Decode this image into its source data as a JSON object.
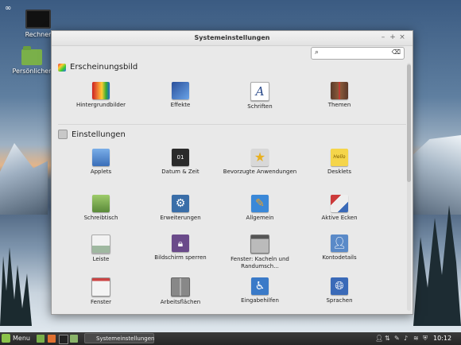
{
  "desktop": {
    "icons": [
      {
        "label": "Rechner",
        "icon": "computer-icon"
      },
      {
        "label": "Persönlicher",
        "icon": "home-folder-icon"
      }
    ]
  },
  "window": {
    "title": "Systemeinstellungen",
    "controls": {
      "minimize": "–",
      "maximize": "+",
      "close": "×"
    },
    "search": {
      "placeholder": ""
    }
  },
  "sections": [
    {
      "title": "Erscheinungsbild",
      "items": [
        {
          "label": "Hintergrundbilder",
          "color": "#d23a2a",
          "icon": "wallpaper-icon"
        },
        {
          "label": "Effekte",
          "color": "#3a78c8",
          "icon": "effects-icon"
        },
        {
          "label": "Schriften",
          "color": "#ffffff",
          "icon": "fonts-icon"
        },
        {
          "label": "Themen",
          "color": "#7a4a3a",
          "icon": "themes-icon"
        }
      ]
    },
    {
      "title": "Einstellungen",
      "items": [
        {
          "label": "Applets",
          "color": "#5a8fd0",
          "icon": "applets-icon"
        },
        {
          "label": "Datum & Zeit",
          "color": "#333333",
          "icon": "calendar-icon"
        },
        {
          "label": "Bevorzugte Anwendungen",
          "color": "#f2d25a",
          "icon": "star-icon"
        },
        {
          "label": "Desklets",
          "color": "#f5d54a",
          "icon": "note-icon"
        },
        {
          "label": "Schreibtisch",
          "color": "#7ab04a",
          "icon": "desktop-icon"
        },
        {
          "label": "Erweiterungen",
          "color": "#3a6ea8",
          "icon": "gear-icon"
        },
        {
          "label": "Allgemein",
          "color": "#3a88d8",
          "icon": "tools-icon"
        },
        {
          "label": "Aktive Ecken",
          "color": "#cc3a3a",
          "icon": "hot-corner-icon"
        },
        {
          "label": "Leiste",
          "color": "#9fb8a0",
          "icon": "panel-icon"
        },
        {
          "label": "Bildschirm sperren",
          "color": "#6a4a8a",
          "icon": "lock-icon"
        },
        {
          "label": "Fenster: Kacheln und Randumsch...",
          "color": "#8a8a8a",
          "icon": "window-tiling-icon"
        },
        {
          "label": "Kontodetails",
          "color": "#5a8ac8",
          "icon": "account-icon"
        },
        {
          "label": "Fenster",
          "color": "#f0f0f0",
          "icon": "windows-icon"
        },
        {
          "label": "Arbeitsflächen",
          "color": "#9a9a9a",
          "icon": "workspaces-icon"
        },
        {
          "label": "Eingabehilfen",
          "color": "#3a7ac8",
          "icon": "accessibility-icon"
        },
        {
          "label": "Sprachen",
          "color": "#3a6ab8",
          "icon": "languages-icon"
        }
      ]
    }
  ],
  "panel": {
    "menu_label": "Menu",
    "task_label": "Systemeinstellungen",
    "clock": "10:12"
  }
}
